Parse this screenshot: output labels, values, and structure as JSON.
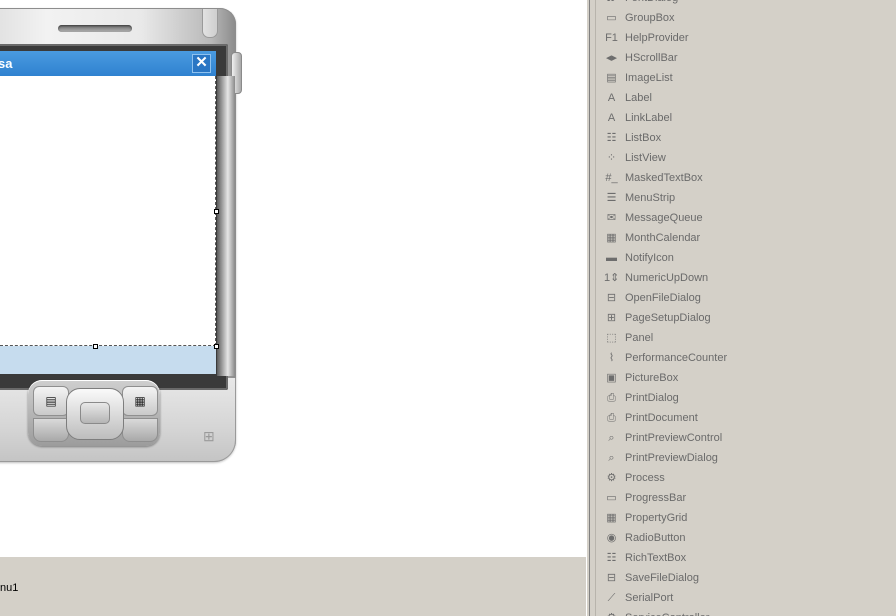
{
  "form": {
    "title": "sa",
    "close_glyph": "✕"
  },
  "tray": {
    "item_label": "nu1"
  },
  "device": {
    "softkey_left_glyph": "▤",
    "softkey_right_glyph": "▦",
    "logo_glyph": "⊞"
  },
  "toolbox": {
    "items": [
      {
        "label": "FontDialog",
        "icon": "font-dialog-icon",
        "glyph": "Ꭿ"
      },
      {
        "label": "GroupBox",
        "icon": "groupbox-icon",
        "glyph": "▭"
      },
      {
        "label": "HelpProvider",
        "icon": "help-provider-icon",
        "glyph": "F1"
      },
      {
        "label": "HScrollBar",
        "icon": "hscrollbar-icon",
        "glyph": "◂▸"
      },
      {
        "label": "ImageList",
        "icon": "imagelist-icon",
        "glyph": "▤"
      },
      {
        "label": "Label",
        "icon": "label-icon",
        "glyph": "A"
      },
      {
        "label": "LinkLabel",
        "icon": "linklabel-icon",
        "glyph": "A"
      },
      {
        "label": "ListBox",
        "icon": "listbox-icon",
        "glyph": "☷"
      },
      {
        "label": "ListView",
        "icon": "listview-icon",
        "glyph": "⁘"
      },
      {
        "label": "MaskedTextBox",
        "icon": "maskedtextbox-icon",
        "glyph": "#_"
      },
      {
        "label": "MenuStrip",
        "icon": "menustrip-icon",
        "glyph": "☰"
      },
      {
        "label": "MessageQueue",
        "icon": "messagequeue-icon",
        "glyph": "✉"
      },
      {
        "label": "MonthCalendar",
        "icon": "monthcalendar-icon",
        "glyph": "▦"
      },
      {
        "label": "NotifyIcon",
        "icon": "notifyicon-icon",
        "glyph": "▬"
      },
      {
        "label": "NumericUpDown",
        "icon": "numericupdown-icon",
        "glyph": "1⇕"
      },
      {
        "label": "OpenFileDialog",
        "icon": "openfiledialog-icon",
        "glyph": "⊟"
      },
      {
        "label": "PageSetupDialog",
        "icon": "pagesetupdialog-icon",
        "glyph": "⊞"
      },
      {
        "label": "Panel",
        "icon": "panel-icon",
        "glyph": "⬚"
      },
      {
        "label": "PerformanceCounter",
        "icon": "performancecounter-icon",
        "glyph": "⌇"
      },
      {
        "label": "PictureBox",
        "icon": "picturebox-icon",
        "glyph": "▣"
      },
      {
        "label": "PrintDialog",
        "icon": "printdialog-icon",
        "glyph": "⎙"
      },
      {
        "label": "PrintDocument",
        "icon": "printdocument-icon",
        "glyph": "⎙"
      },
      {
        "label": "PrintPreviewControl",
        "icon": "printpreviewcontrol-icon",
        "glyph": "⌕"
      },
      {
        "label": "PrintPreviewDialog",
        "icon": "printpreviewdialog-icon",
        "glyph": "⌕"
      },
      {
        "label": "Process",
        "icon": "process-icon",
        "glyph": "⚙"
      },
      {
        "label": "ProgressBar",
        "icon": "progressbar-icon",
        "glyph": "▭"
      },
      {
        "label": "PropertyGrid",
        "icon": "propertygrid-icon",
        "glyph": "▦"
      },
      {
        "label": "RadioButton",
        "icon": "radiobutton-icon",
        "glyph": "◉"
      },
      {
        "label": "RichTextBox",
        "icon": "richtextbox-icon",
        "glyph": "☷"
      },
      {
        "label": "SaveFileDialog",
        "icon": "savefiledialog-icon",
        "glyph": "⊟"
      },
      {
        "label": "SerialPort",
        "icon": "serialport-icon",
        "glyph": "⟋"
      },
      {
        "label": "ServiceController",
        "icon": "servicecontroller-icon",
        "glyph": "⚙"
      }
    ]
  }
}
